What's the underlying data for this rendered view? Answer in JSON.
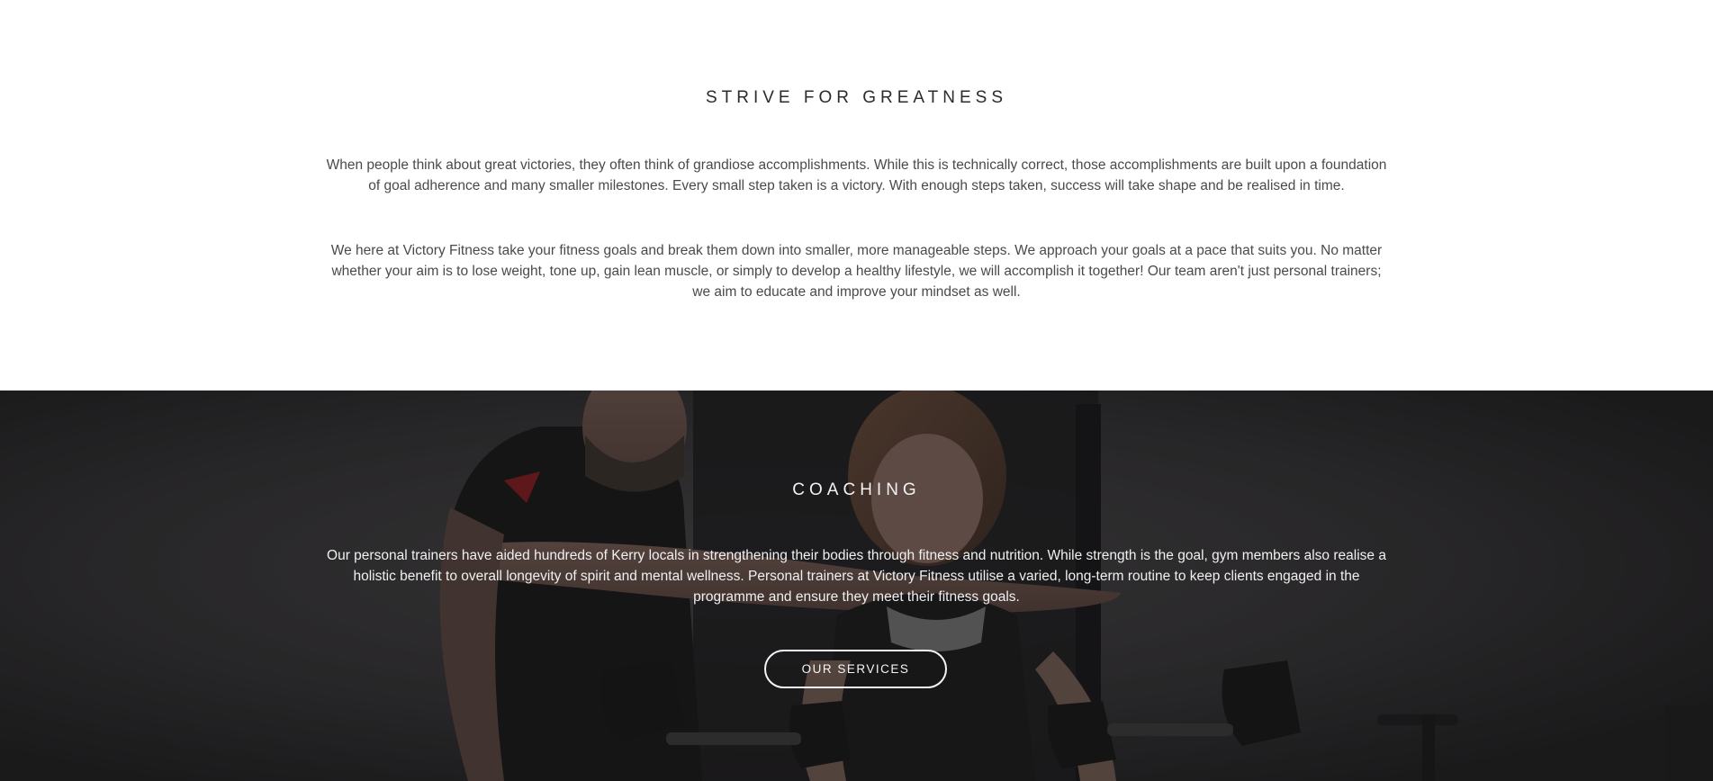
{
  "intro": {
    "title": "STRIVE FOR GREATNESS",
    "paragraph_1": "When people think about great victories, they often think of grandiose accomplishments. While this is technically correct, those accomplishments are built upon a foundation of goal adherence and many smaller milestones. Every small step taken is a victory. With enough steps taken, success will take shape and be realised in time.",
    "paragraph_2": "We here at Victory Fitness take your fitness goals and break them down into smaller, more manageable steps. We approach your goals at a pace that suits you. No matter whether your aim is to lose weight, tone up, gain lean muscle, or simply to develop a healthy lifestyle, we will accomplish it together! Our team aren't just personal trainers; we aim to educate and improve your mindset as well."
  },
  "coaching": {
    "title": "COACHING",
    "paragraph": "Our personal trainers have aided hundreds of Kerry locals in strengthening their bodies through fitness and nutrition. While strength is the goal, gym members also realise a holistic benefit to overall longevity of spirit and mental wellness. Personal trainers at Victory Fitness utilise a varied, long-term routine to keep clients engaged in the programme and ensure they meet their fitness goals.",
    "button_label": "OUR SERVICES",
    "background_image": "trainer-and-client-dumbbell-curl-photo"
  },
  "colors": {
    "page_background": "#ffffff",
    "heading_dark": "#2b2b2b",
    "body_text": "#4a4a4a",
    "hero_background": "#262527",
    "hero_text": "#f0f0f0"
  }
}
